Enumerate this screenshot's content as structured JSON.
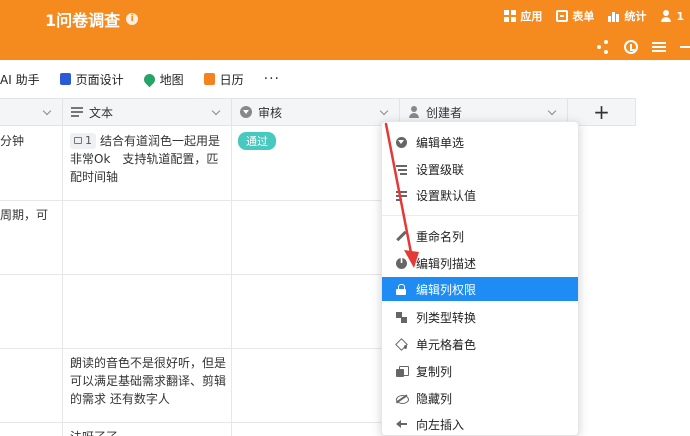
{
  "header": {
    "title": "1问卷调查",
    "nav": [
      {
        "label": "应用",
        "icon": "app-grid-icon"
      },
      {
        "label": "表单",
        "icon": "form-icon"
      },
      {
        "label": "统计",
        "icon": "stats-icon"
      },
      {
        "label": "1",
        "icon": "members-icon"
      }
    ],
    "tools": [
      "share-icon",
      "history-icon",
      "settings-sliders-icon",
      "more-icon"
    ]
  },
  "toolbar": {
    "ai_label": "AI 助手",
    "page_design_label": "页面设计",
    "map_label": "地图",
    "calendar_label": "日历",
    "more_label": "···"
  },
  "grid": {
    "columns": {
      "text": "文本",
      "review": "审核",
      "creator": "创建者",
      "add": "+"
    },
    "cells": {
      "r1_partial": "分钟",
      "r1_count": "1",
      "r1_text_line1": "结合有道润色一起用是",
      "r1_text_line2": "非常Ok　支持轨道配置，匹",
      "r1_text_line3": "配时间轴",
      "r1_status": "通过",
      "r2_partial": "周期，可",
      "r4_text_line1": "朗读的音色不是很好听，但是",
      "r4_text_line2": "可以满足基础需求翻译、剪辑",
      "r4_text_line3": "的需求  还有数字人",
      "r5_text_line1": "法呀了了"
    }
  },
  "context_menu": {
    "items": [
      {
        "label": "编辑单选",
        "icon": "edit-select-icon"
      },
      {
        "label": "设置级联",
        "icon": "cascade-icon"
      },
      {
        "label": "设置默认值",
        "icon": "default-value-icon"
      },
      {
        "label": "重命名列",
        "icon": "rename-icon"
      },
      {
        "label": "编辑列描述",
        "icon": "info-icon"
      },
      {
        "label": "编辑列权限",
        "icon": "lock-icon"
      },
      {
        "label": "列类型转换",
        "icon": "convert-icon"
      },
      {
        "label": "单元格着色",
        "icon": "paint-bucket-icon"
      },
      {
        "label": "复制列",
        "icon": "copy-icon"
      },
      {
        "label": "隐藏列",
        "icon": "hide-icon"
      },
      {
        "label": "向左插入",
        "icon": "insert-left-icon"
      }
    ],
    "active_index": 5
  },
  "colors": {
    "header_bg": "#f58a1f",
    "active_item": "#1e8cf2",
    "status_tag": "#47c9c0",
    "annotation_arrow": "#e53935"
  }
}
